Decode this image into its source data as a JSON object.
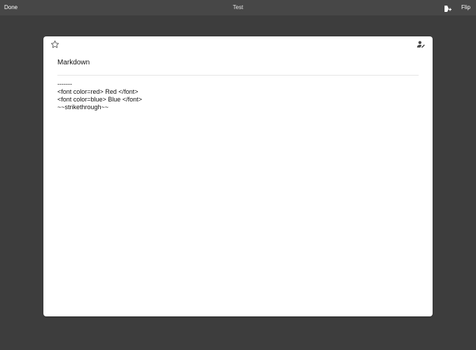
{
  "topbar": {
    "done_label": "Done",
    "title": "Test",
    "flip_label": "Flip",
    "add_icon": "card-plus-icon"
  },
  "card": {
    "star_icon": "star-outline-icon",
    "edit_icon": "person-edit-icon",
    "title": "Markdown",
    "lines": [
      "-------",
      "<font color=red> Red </font>",
      "<font color=blue> Blue </font>",
      "~~strikethrough~~"
    ]
  }
}
